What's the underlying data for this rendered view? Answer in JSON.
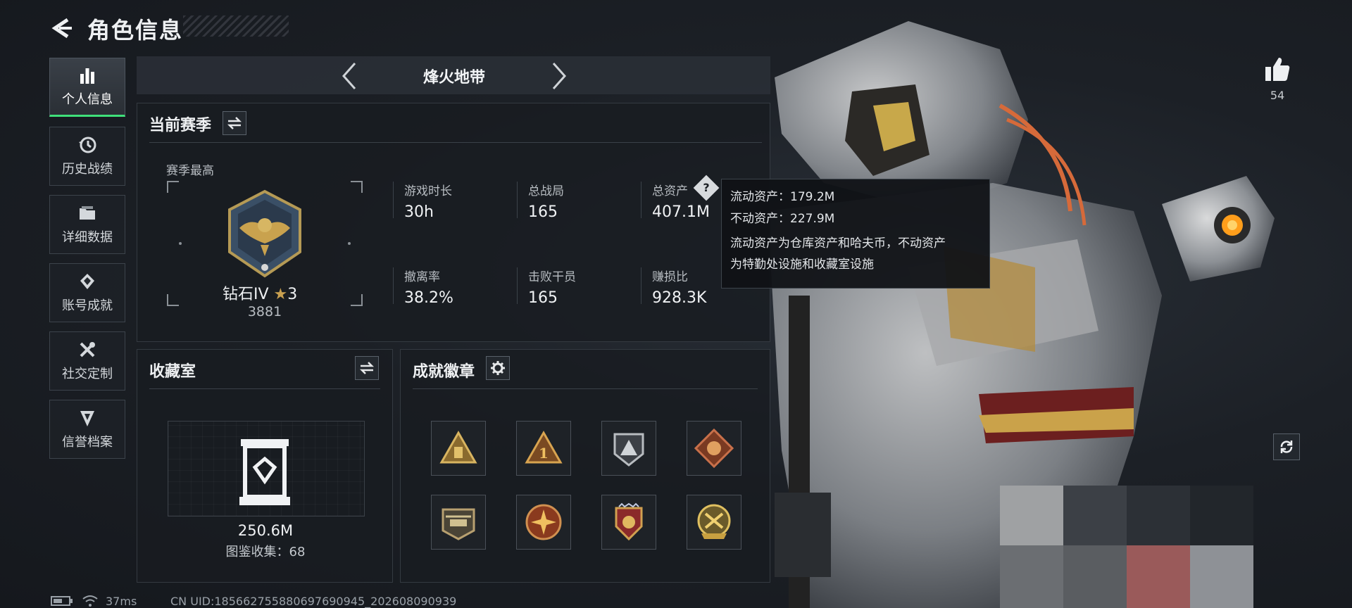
{
  "header": {
    "title": "角色信息"
  },
  "nav": [
    {
      "label": "个人信息",
      "icon": "bar-chart-icon",
      "active": true
    },
    {
      "label": "历史战绩",
      "icon": "history-clock-icon"
    },
    {
      "label": "详细数据",
      "icon": "folder-icon"
    },
    {
      "label": "账号成就",
      "icon": "achievement-diamond-icon"
    },
    {
      "label": "社交定制",
      "icon": "tools-wrench-icon"
    },
    {
      "label": "信誉档案",
      "icon": "shield-badge-icon"
    }
  ],
  "mode": {
    "name": "烽火地带"
  },
  "season": {
    "title": "当前赛季",
    "best_label": "赛季最高",
    "rank_name": "钻石IV",
    "rank_stars": "3",
    "rank_points": "3881",
    "stats": [
      {
        "label": "游戏时长",
        "value": "30h"
      },
      {
        "label": "总战局",
        "value": "165"
      },
      {
        "label": "总资产",
        "value": "407.1M"
      },
      {
        "label": "撤离率",
        "value": "38.2%"
      },
      {
        "label": "击败干员",
        "value": "165"
      },
      {
        "label": "赚损比",
        "value": "928.3K"
      }
    ]
  },
  "tooltip": {
    "line1": "流动资产：179.2M",
    "line2": "不动资产：227.9M",
    "desc1": "流动资产为仓库资产和哈夫币，不动资产",
    "desc2": "为特勤处设施和收藏室设施"
  },
  "collection": {
    "title": "收藏室",
    "value": "250.6M",
    "catalog": "图鉴收集：68"
  },
  "badges": {
    "title": "成就徽章",
    "items": [
      "triangle-rank-badge",
      "number-one-badge",
      "silver-triangle-badge",
      "dragon-badge",
      "helicopter-badge",
      "star-compass-badge",
      "eagle-crest-badge",
      "gold-emblem-badge"
    ]
  },
  "likes": {
    "count": "54"
  },
  "status": {
    "ping": "37ms",
    "uid": "CN UID:185662755880697690945_202608090939"
  },
  "colors": {
    "accent": "#3fe07a",
    "gold": "#c8a050",
    "bg": "#1c2026"
  }
}
